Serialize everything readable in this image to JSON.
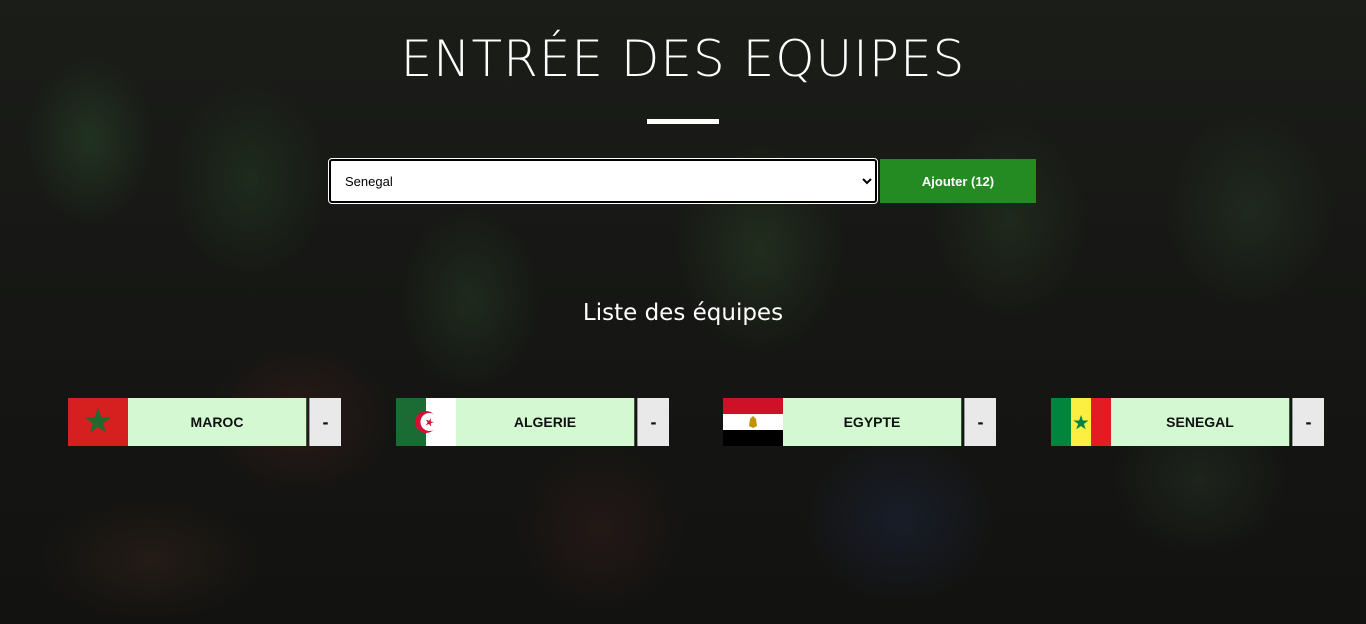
{
  "header": {
    "title": "ENTRÉE DES EQUIPES"
  },
  "form": {
    "selected_team": "Senegal",
    "options": [
      "Senegal"
    ],
    "add_button_label": "Ajouter (12)"
  },
  "list": {
    "title": "Liste des équipes",
    "remove_label": "-",
    "teams": [
      {
        "name": "MAROC",
        "flag": "morocco-flag-icon"
      },
      {
        "name": "ALGERIE",
        "flag": "algeria-flag-icon"
      },
      {
        "name": "EGYPTE",
        "flag": "egypt-flag-icon"
      },
      {
        "name": "SENEGAL",
        "flag": "senegal-flag-icon"
      }
    ]
  },
  "colors": {
    "add_button": "#238b22",
    "team_name_bg": "#d4f8d2",
    "remove_button_bg": "#e9e9e9"
  }
}
